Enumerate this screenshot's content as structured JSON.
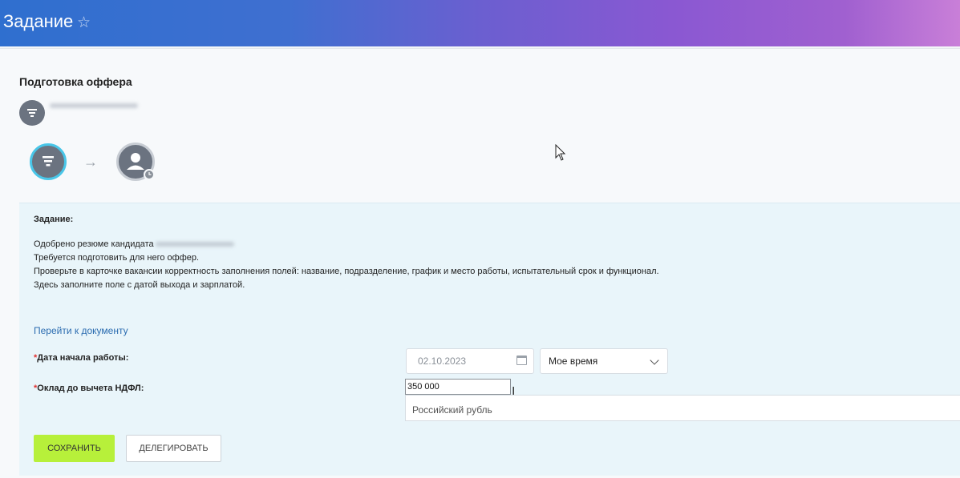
{
  "header": {
    "title": "Задание",
    "star_icon": "star-outline-icon"
  },
  "page": {
    "title": "Подготовка оффера",
    "owner_name_blurred": ""
  },
  "workflow": {
    "step1_icon": "filter-list-icon",
    "arrow_icon": "arrow-right-icon",
    "step2_icon": "user-icon",
    "step2_badge_icon": "clock-icon"
  },
  "task": {
    "label": "Задание:",
    "line1_prefix": "Одобрено резюме кандидата",
    "line2": "Требуется подготовить для него оффер.",
    "line3": "Проверьте в карточке вакансии корректность заполнения полей: название,  подразделение, график и место работы, испытательный срок и функционал.",
    "line4": "Здесь заполните поле с датой выхода и зарплатой.",
    "doc_link": "Перейти к документу"
  },
  "form": {
    "start_date_label": "Дата начала работы:",
    "start_date_value": "02.10.2023",
    "timezone_value": "Мое время",
    "salary_label": "Оклад до вычета НДФЛ:",
    "salary_value": "350 000",
    "currency_value": "Российский рубль",
    "required_mark": "*"
  },
  "buttons": {
    "save": "СОХРАНИТЬ",
    "delegate": "ДЕЛЕГИРОВАТЬ"
  },
  "colors": {
    "accent_link": "#2b6cb0",
    "save_button": "#b7f03a",
    "step_active_ring": "#49c6e8",
    "required": "#e03030"
  }
}
